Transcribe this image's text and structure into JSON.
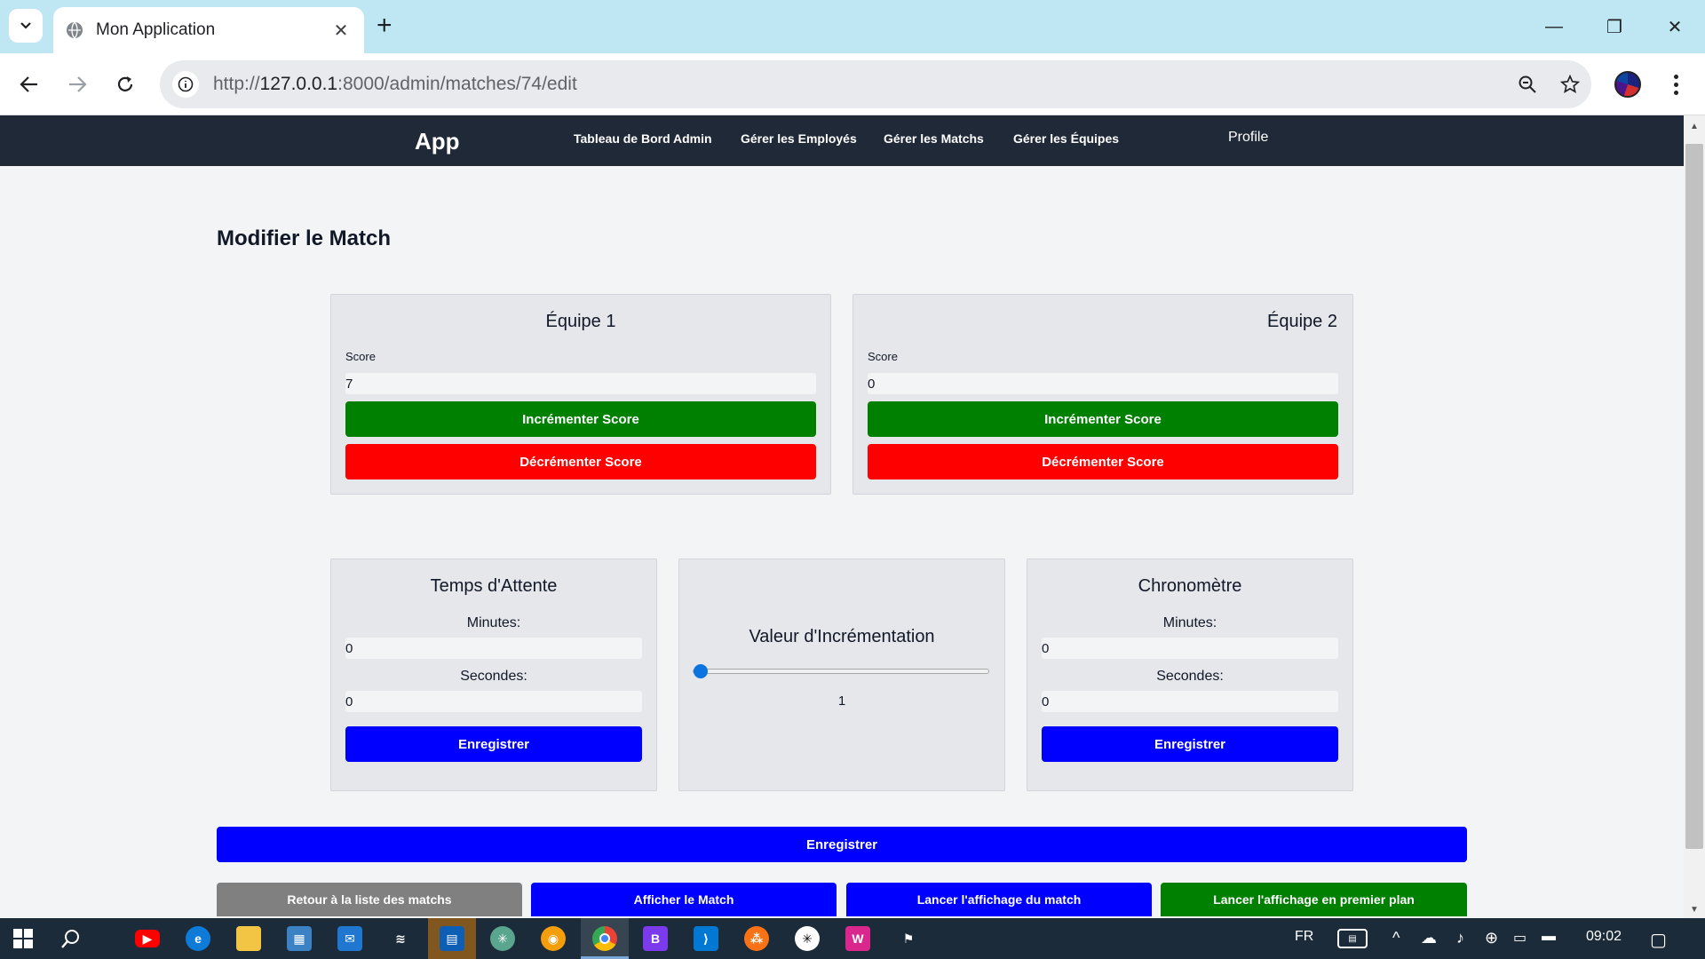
{
  "browser": {
    "tab_title": "Mon Application",
    "new_tab": "+",
    "url_prefix": "http://",
    "url_host": "127.0.0.1",
    "url_rest": ":8000/admin/matches/74/edit"
  },
  "nav": {
    "brand": "App",
    "links": [
      "Tableau de Bord Admin",
      "Gérer les Employés",
      "Gérer les Matchs",
      "Gérer les Équipes"
    ],
    "profile": "Profile"
  },
  "page": {
    "title": "Modifier le Match"
  },
  "team1": {
    "title": "Équipe 1",
    "score_label": "Score",
    "score_value": "7",
    "increment_label": "Incrémenter Score",
    "decrement_label": "Décrémenter Score"
  },
  "team2": {
    "title": "Équipe 2",
    "score_label": "Score",
    "score_value": "0",
    "increment_label": "Incrémenter Score",
    "decrement_label": "Décrémenter Score"
  },
  "wait_time": {
    "title": "Temps d'Attente",
    "minutes_label": "Minutes:",
    "minutes_value": "0",
    "seconds_label": "Secondes:",
    "seconds_value": "0",
    "save_label": "Enregistrer"
  },
  "increment": {
    "title": "Valeur d'Incrémentation",
    "slider_value": 1,
    "value_text": "1"
  },
  "chrono": {
    "title": "Chronomètre",
    "minutes_label": "Minutes:",
    "minutes_value": "0",
    "seconds_label": "Secondes:",
    "seconds_value": "0",
    "save_label": "Enregistrer"
  },
  "actions": {
    "save_all": "Enregistrer",
    "back": "Retour à la liste des matchs",
    "show_match": "Afficher le Match",
    "launch_display": "Lancer l'affichage du match",
    "launch_foreground": "Lancer l'affichage en premier plan"
  },
  "taskbar": {
    "lang": "FR",
    "time": "09:02"
  },
  "colors": {
    "nav_bg": "#1f2937",
    "green": "#008000",
    "red": "#ff0000",
    "blue": "#0000ff",
    "gray": "#808080"
  }
}
